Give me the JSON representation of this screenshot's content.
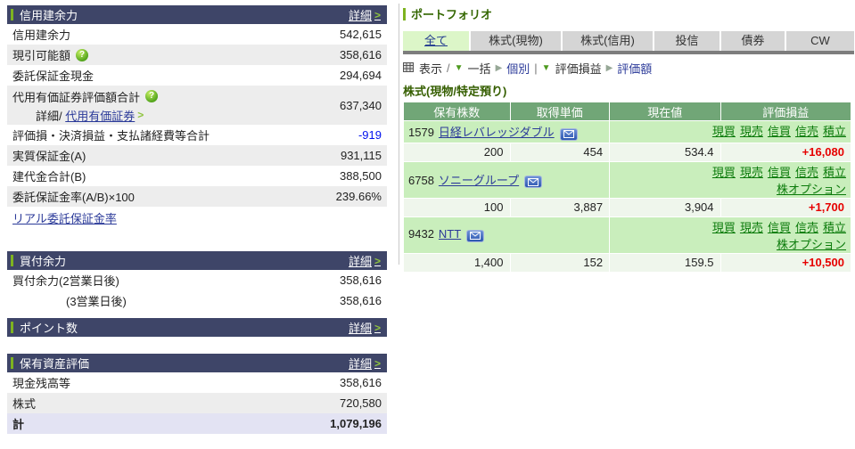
{
  "glyphs": {
    "chevron": ">",
    "tri_down": "▼",
    "tri_right": "▶",
    "help": "?"
  },
  "left_panel": {
    "credit_section": {
      "title": "信用建余力",
      "detail_label": "詳細",
      "rows": [
        {
          "label": "信用建余力",
          "value": "542,615"
        },
        {
          "label": "現引可能額",
          "value": "358,616"
        },
        {
          "label": "委託保証金現金",
          "value": "294,694"
        },
        {
          "label": "代用有価証券評価額合計",
          "value": "637,340",
          "sub_prefix": "詳細/",
          "sub_link": "代用有価証券"
        },
        {
          "label": "評価損・決済損益・支払諸経費等合計",
          "value": "-919"
        },
        {
          "label": "実質保証金(A)",
          "value": "931,115"
        },
        {
          "label": "建代金合計(B)",
          "value": "388,500"
        },
        {
          "label": "委託保証金率(A/B)×100",
          "value": "239.66%"
        }
      ],
      "footer_link": "リアル委託保証金率"
    },
    "buying_section": {
      "title": "買付余力",
      "detail_label": "詳細",
      "rows": [
        {
          "label": "買付余力(2営業日後)",
          "value": "358,616"
        },
        {
          "label": "(3営業日後)",
          "value": "358,616"
        }
      ]
    },
    "points_section": {
      "title": "ポイント数",
      "detail_label": "詳細"
    },
    "assets_section": {
      "title": "保有資産評価",
      "detail_label": "詳細",
      "rows": [
        {
          "label": "現金残高等",
          "value": "358,616"
        },
        {
          "label": "株式",
          "value": "720,580"
        },
        {
          "label": "計",
          "value": "1,079,196"
        }
      ]
    }
  },
  "right_panel": {
    "title": "ポートフォリオ",
    "tabs": [
      {
        "label": "全て"
      },
      {
        "label": "株式(現物)"
      },
      {
        "label": "株式(信用)"
      },
      {
        "label": "投信"
      },
      {
        "label": "債券"
      },
      {
        "label": "CW"
      }
    ],
    "toolbar": {
      "view": "表示",
      "slash": "/",
      "batch": "一括",
      "individual": "個別",
      "pipe": "|",
      "pl_mode": "評価損益",
      "valuation_mode": "評価額"
    },
    "subtitle": "株式(現物/特定預り)",
    "table": {
      "headers": [
        "保有株数",
        "取得単価",
        "現在値",
        "評価損益"
      ],
      "stocks": [
        {
          "code": "1579",
          "name": "日経レバレッジダブル",
          "actions": [
            "現買",
            "現売",
            "信買",
            "信売",
            "積立"
          ],
          "shares": "200",
          "unit_cost": "454",
          "current": "534.4",
          "pl": "+16,080"
        },
        {
          "code": "6758",
          "name": "ソニーグループ",
          "actions": [
            "現買",
            "現売",
            "信買",
            "信売",
            "積立"
          ],
          "option_link": "株オプション",
          "shares": "100",
          "unit_cost": "3,887",
          "current": "3,904",
          "pl": "+1,700"
        },
        {
          "code": "9432",
          "name": "NTT",
          "actions": [
            "現買",
            "現売",
            "信買",
            "信売",
            "積立"
          ],
          "option_link": "株オプション",
          "shares": "1,400",
          "unit_cost": "152",
          "current": "159.5",
          "pl": "+10,500"
        }
      ]
    }
  }
}
